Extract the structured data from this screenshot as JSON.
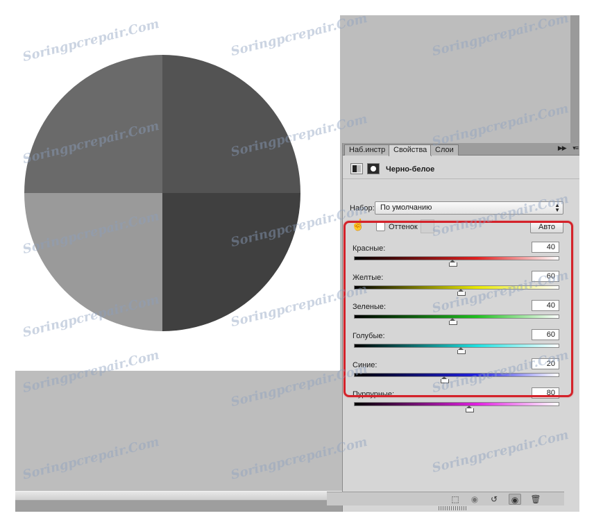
{
  "panel": {
    "tabs": [
      {
        "label": "Наб.инстр",
        "active": false
      },
      {
        "label": "Свойства",
        "active": true
      },
      {
        "label": "Слои",
        "active": false
      }
    ],
    "menu_icons": [
      "collapse-icon",
      "panel-menu-icon"
    ],
    "title": "Черно-белое",
    "preset_label": "Набор:",
    "preset_value": "По умолчанию",
    "tint_label": "Оттенок",
    "tint_checked": false,
    "auto_label": "Авто",
    "sliders": [
      {
        "label": "Красные:",
        "value": "40",
        "color": "#e02020"
      },
      {
        "label": "Желтые:",
        "value": "60",
        "color": "#e8e800"
      },
      {
        "label": "Зеленые:",
        "value": "40",
        "color": "#20c020"
      },
      {
        "label": "Голубые:",
        "value": "60",
        "color": "#20e0e0"
      },
      {
        "label": "Синие:",
        "value": "20",
        "color": "#2020e0"
      },
      {
        "label": "Пурпурные:",
        "value": "80",
        "color": "#e020e0"
      }
    ],
    "slider_range": [
      -200,
      300
    ],
    "footer_icons": [
      "clip-to-layer-icon",
      "view-previous-icon",
      "reset-icon",
      "visibility-eye-icon",
      "trash-icon"
    ]
  },
  "canvas": {
    "quadrant_colors": {
      "top_left": "#6a6a6a",
      "top_right": "#535353",
      "bottom_left": "#9a9a9a",
      "bottom_right": "#404040"
    }
  },
  "watermark": "Soringpcrepair.Com",
  "highlight_color": "#d4222a"
}
